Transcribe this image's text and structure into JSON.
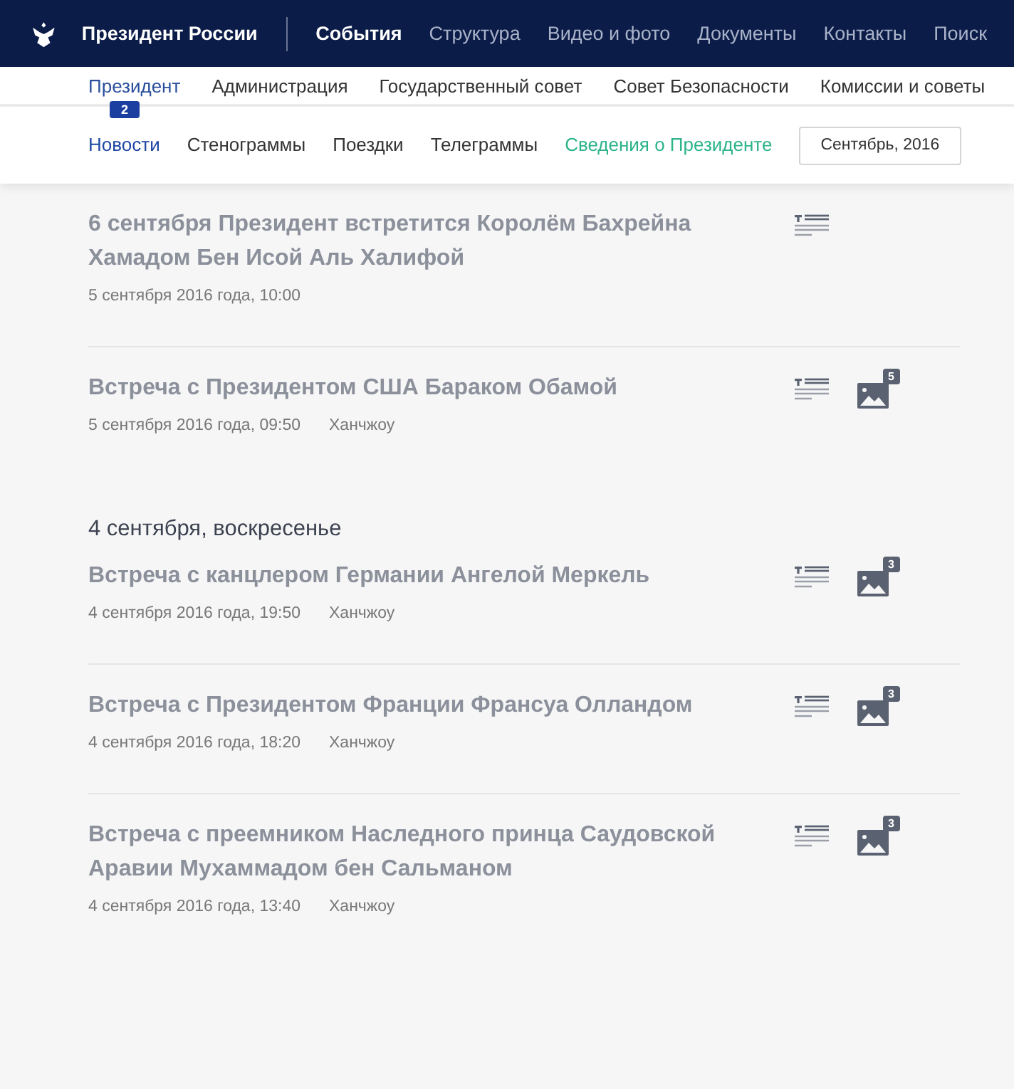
{
  "header": {
    "site_title": "Президент России",
    "nav": [
      {
        "label": "События",
        "selected": true
      },
      {
        "label": "Структура",
        "selected": false
      },
      {
        "label": "Видео и фото",
        "selected": false
      },
      {
        "label": "Документы",
        "selected": false
      },
      {
        "label": "Контакты",
        "selected": false
      },
      {
        "label": "Поиск",
        "selected": false
      }
    ]
  },
  "subnav": [
    {
      "label": "Президент",
      "selected": true
    },
    {
      "label": "Администрация",
      "selected": false
    },
    {
      "label": "Государственный совет",
      "selected": false
    },
    {
      "label": "Совет Безопасности",
      "selected": false
    },
    {
      "label": "Комиссии и советы",
      "selected": false
    }
  ],
  "tabs": [
    {
      "label": "Новости",
      "selected": true,
      "badge": "2",
      "kind": "tab"
    },
    {
      "label": "Стенограммы",
      "selected": false,
      "kind": "tab"
    },
    {
      "label": "Поездки",
      "selected": false,
      "kind": "tab"
    },
    {
      "label": "Телеграммы",
      "selected": false,
      "kind": "tab"
    },
    {
      "label": "Сведения о Президенте",
      "selected": false,
      "kind": "highlight"
    }
  ],
  "month_button": "Сентябрь, 2016",
  "feed": [
    {
      "kind": "item",
      "title": "6 сентября Президент встретится Королём Бахрейна Хамадом Бен Исой Аль Халифой",
      "date": "5 сентября 2016 года, 10:00"
    },
    {
      "kind": "item",
      "title": "Встреча с Президентом США Бараком Обамой",
      "date": "5 сентября 2016 года, 09:50",
      "place": "Ханчжоу",
      "photos": "5"
    },
    {
      "kind": "heading",
      "text": "4 сентября, воскресенье"
    },
    {
      "kind": "item",
      "title": "Встреча с канцлером Германии Ангелой Меркель",
      "date": "4 сентября 2016 года, 19:50",
      "place": "Ханчжоу",
      "photos": "3"
    },
    {
      "kind": "item",
      "title": "Встреча с Президентом Франции Франсуа Олландом",
      "date": "4 сентября 2016 года, 18:20",
      "place": "Ханчжоу",
      "photos": "3"
    },
    {
      "kind": "item",
      "title": "Встреча с преемником Наследного принца Саудовской Аравии Мухаммадом бен Сальманом",
      "date": "4 сентября 2016 года, 13:40",
      "place": "Ханчжоу",
      "photos": "3"
    }
  ]
}
